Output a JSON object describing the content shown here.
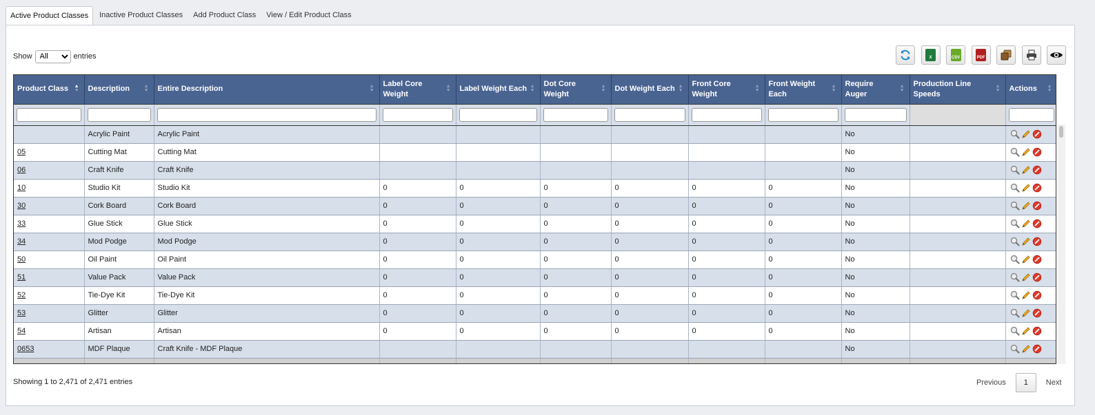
{
  "tabs": [
    {
      "label": "Active Product Classes",
      "active": true
    },
    {
      "label": "Inactive Product Classes",
      "active": false
    },
    {
      "label": "Add Product Class",
      "active": false
    },
    {
      "label": "View / Edit Product Class",
      "active": false
    }
  ],
  "length_control": {
    "show_label": "Show",
    "selected": "All",
    "entries_label": "entries"
  },
  "toolbar": [
    {
      "name": "refresh-icon"
    },
    {
      "name": "excel-export-icon",
      "text": "X"
    },
    {
      "name": "csv-export-icon",
      "text": "CSV"
    },
    {
      "name": "pdf-export-icon",
      "text": "PDF"
    },
    {
      "name": "copy-icon"
    },
    {
      "name": "print-icon"
    },
    {
      "name": "column-visibility-icon"
    }
  ],
  "columns": [
    {
      "key": "product_class",
      "label": "Product Class",
      "sorted": "asc"
    },
    {
      "key": "description",
      "label": "Description"
    },
    {
      "key": "entire_description",
      "label": "Entire Description"
    },
    {
      "key": "label_core_weight",
      "label": "Label Core Weight"
    },
    {
      "key": "label_weight_each",
      "label": "Label Weight Each"
    },
    {
      "key": "dot_core_weight",
      "label": "Dot Core Weight"
    },
    {
      "key": "dot_weight_each",
      "label": "Dot Weight Each"
    },
    {
      "key": "front_core_weight",
      "label": "Front Core Weight"
    },
    {
      "key": "front_weight_each",
      "label": "Front Weight Each"
    },
    {
      "key": "require_auger",
      "label": "Require Auger"
    },
    {
      "key": "production_line_speeds",
      "label": "Production Line Speeds"
    },
    {
      "key": "actions",
      "label": "Actions"
    }
  ],
  "rows": [
    [
      "",
      "Acrylic Paint",
      "Acrylic Paint",
      "",
      "",
      "",
      "",
      "",
      "",
      "No",
      ""
    ],
    [
      "05",
      "Cutting Mat",
      "Cutting Mat",
      "",
      "",
      "",
      "",
      "",
      "",
      "No",
      ""
    ],
    [
      "06",
      "Craft Knife",
      "Craft Knife",
      "",
      "",
      "",
      "",
      "",
      "",
      "No",
      ""
    ],
    [
      "10",
      "Studio Kit",
      "Studio Kit",
      "0",
      "0",
      "0",
      "0",
      "0",
      "0",
      "No",
      ""
    ],
    [
      "30",
      "Cork Board",
      "Cork Board",
      "0",
      "0",
      "0",
      "0",
      "0",
      "0",
      "No",
      ""
    ],
    [
      "33",
      "Glue Stick",
      "Glue Stick",
      "0",
      "0",
      "0",
      "0",
      "0",
      "0",
      "No",
      ""
    ],
    [
      "34",
      "Mod Podge",
      "Mod Podge",
      "0",
      "0",
      "0",
      "0",
      "0",
      "0",
      "No",
      ""
    ],
    [
      "50",
      "Oil Paint",
      "Oil Paint",
      "0",
      "0",
      "0",
      "0",
      "0",
      "0",
      "No",
      ""
    ],
    [
      "51",
      "Value Pack",
      "Value Pack",
      "0",
      "0",
      "0",
      "0",
      "0",
      "0",
      "No",
      ""
    ],
    [
      "52",
      "Tie-Dye Kit",
      "Tie-Dye Kit",
      "0",
      "0",
      "0",
      "0",
      "0",
      "0",
      "No",
      ""
    ],
    [
      "53",
      "Glitter",
      "Glitter",
      "0",
      "0",
      "0",
      "0",
      "0",
      "0",
      "No",
      ""
    ],
    [
      "54",
      "Artisan",
      "Artisan",
      "0",
      "0",
      "0",
      "0",
      "0",
      "0",
      "No",
      ""
    ],
    [
      "0653",
      "MDF Plaque",
      "Craft Knife - MDF Plaque",
      "",
      "",
      "",
      "",
      "",
      "",
      "No",
      ""
    ]
  ],
  "footer": {
    "info": "Showing 1 to 2,471 of 2,471 entries",
    "previous": "Previous",
    "current_page": "1",
    "next": "Next"
  },
  "colors": {
    "header_bg": "#4a6491",
    "odd_row": "#d7dfea",
    "even_row": "#ffffff"
  }
}
